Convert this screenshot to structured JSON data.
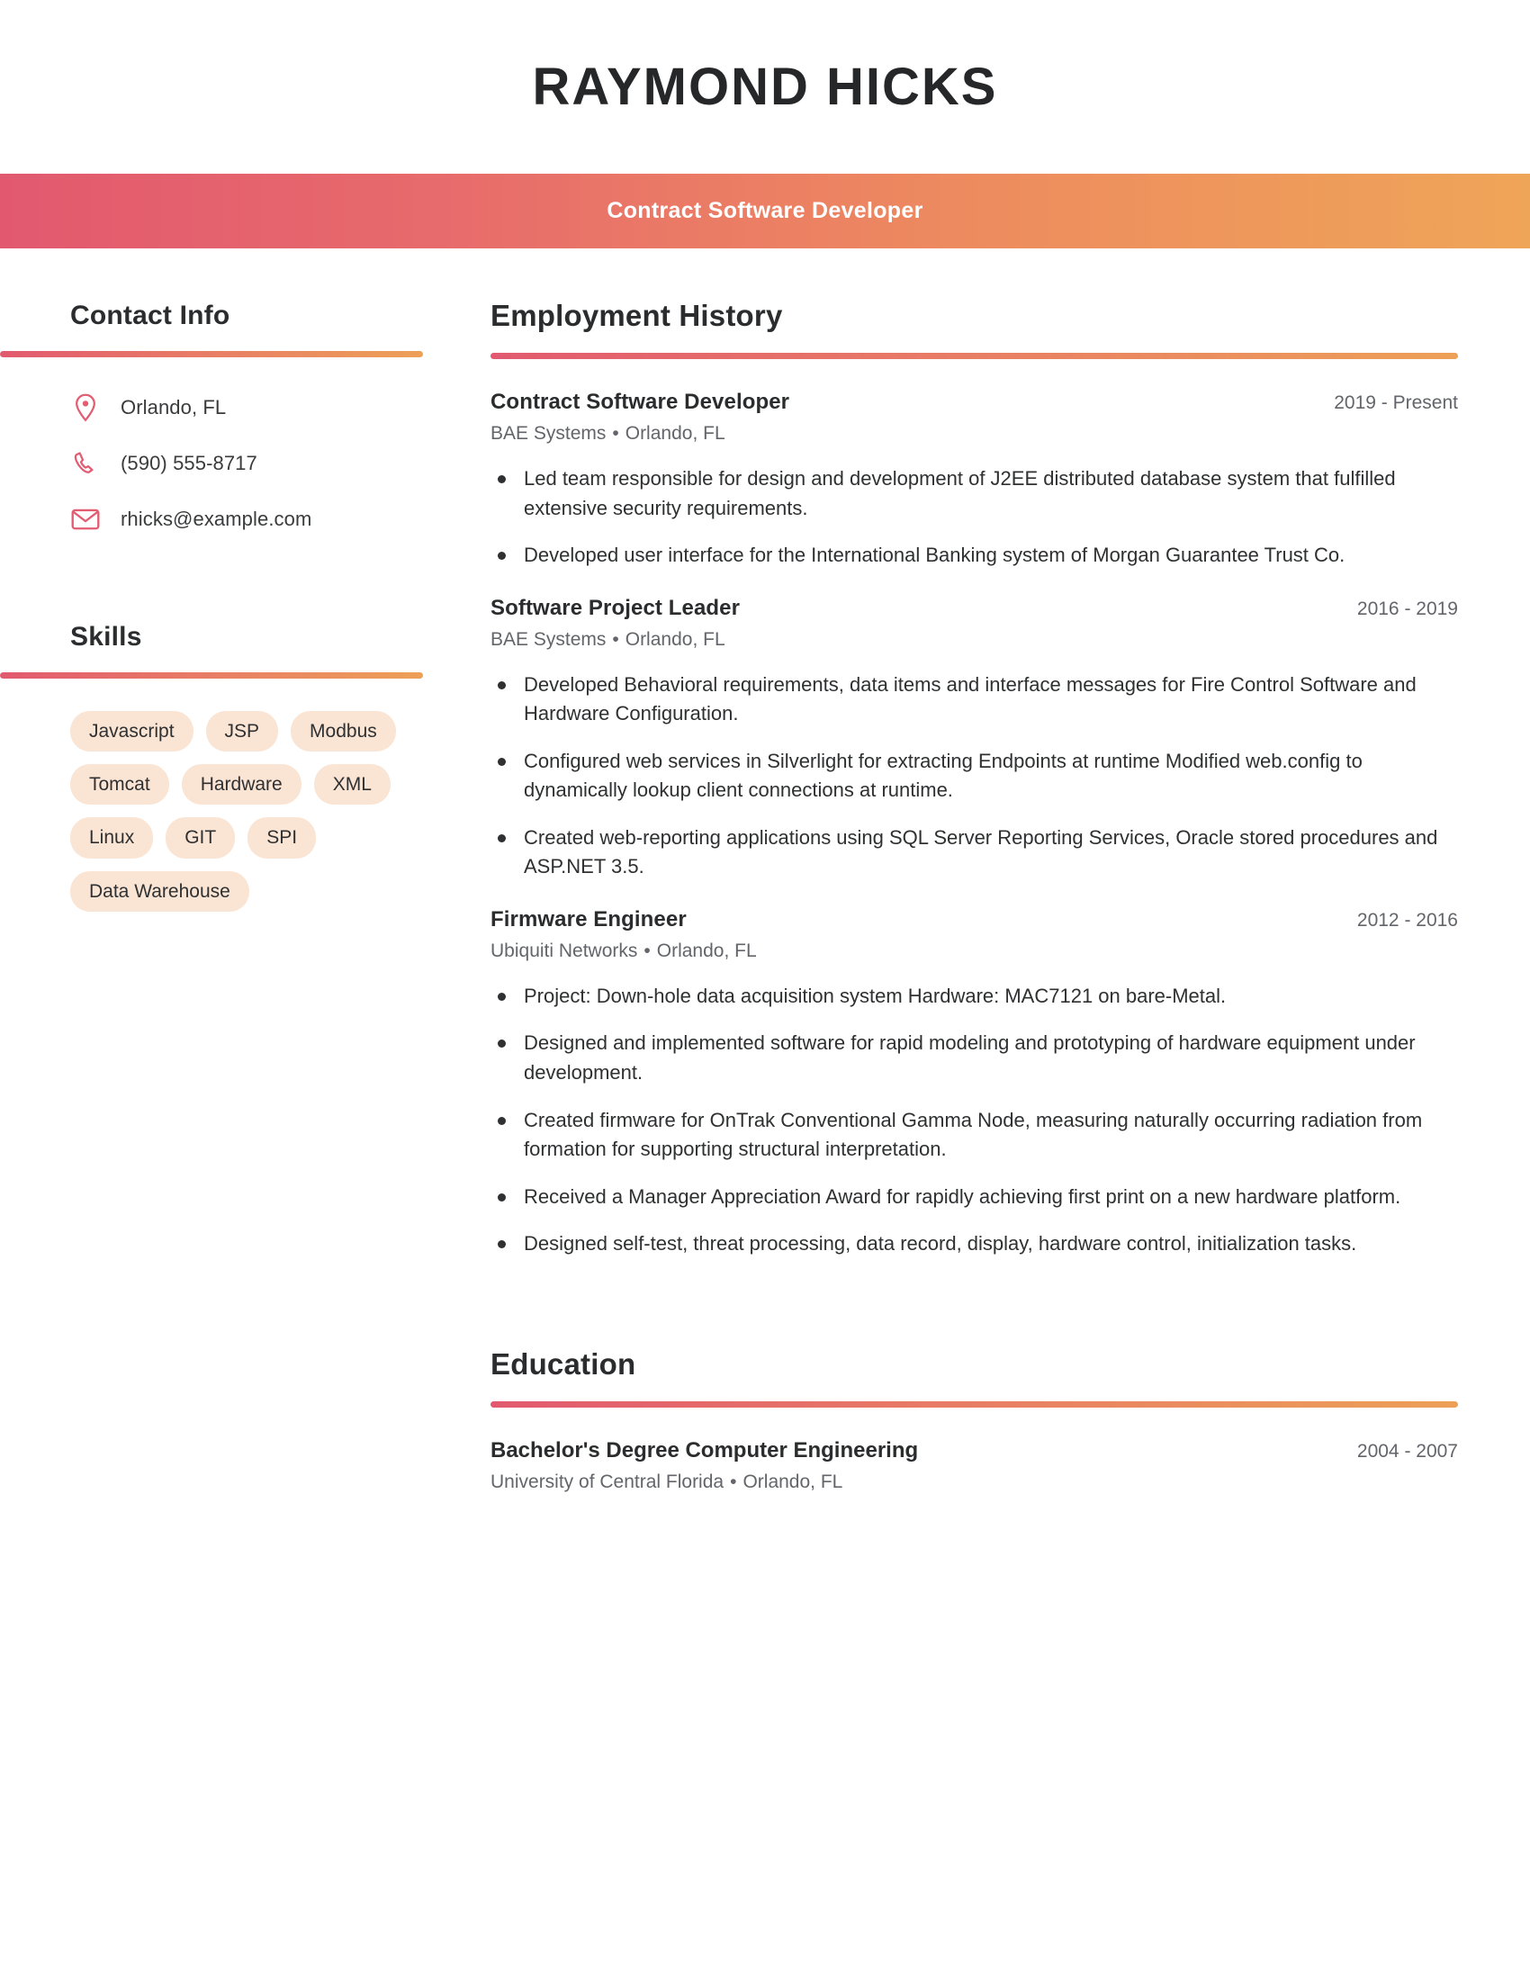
{
  "header": {
    "name": "RAYMOND HICKS",
    "title": "Contract Software Developer",
    "accent_start": "#e2596f",
    "accent_end": "#efa558"
  },
  "sidebar": {
    "contact": {
      "heading": "Contact Info",
      "items": [
        {
          "icon": "location-pin-icon",
          "value": "Orlando, FL"
        },
        {
          "icon": "phone-icon",
          "value": "(590) 555-8717"
        },
        {
          "icon": "envelope-icon",
          "value": "rhicks@example.com"
        }
      ]
    },
    "skills": {
      "heading": "Skills",
      "items": [
        "Javascript",
        "JSP",
        "Modbus",
        "Tomcat",
        "Hardware",
        "XML",
        "Linux",
        "GIT",
        "SPI",
        "Data Warehouse"
      ],
      "pill_background": "#fae4d4"
    }
  },
  "main": {
    "employment": {
      "heading": "Employment History",
      "jobs": [
        {
          "title": "Contract Software Developer",
          "dates": "2019 - Present",
          "company": "BAE Systems",
          "location": "Orlando, FL",
          "bullets": [
            "Led team responsible for design and development of J2EE distributed database system that fulfilled extensive security requirements.",
            "Developed user interface for the International Banking system of Morgan Guarantee Trust Co."
          ]
        },
        {
          "title": "Software Project Leader",
          "dates": "2016 - 2019",
          "company": "BAE Systems",
          "location": "Orlando, FL",
          "bullets": [
            "Developed Behavioral requirements, data items and interface messages for Fire Control Software and Hardware Configuration.",
            "Configured web services in Silverlight for extracting Endpoints at runtime Modified web.config to dynamically lookup client connections at runtime.",
            "Created web-reporting applications using SQL Server Reporting Services, Oracle stored procedures and ASP.NET 3.5."
          ]
        },
        {
          "title": "Firmware Engineer",
          "dates": "2012 - 2016",
          "company": "Ubiquiti Networks",
          "location": "Orlando, FL",
          "bullets": [
            "Project: Down-hole data acquisition system Hardware: MAC7121 on bare-Metal.",
            "Designed and implemented software for rapid modeling and prototyping of hardware equipment under development.",
            "Created firmware for OnTrak Conventional Gamma Node, measuring naturally occurring radiation from formation for supporting structural interpretation.",
            "Received a Manager Appreciation Award for rapidly achieving first print on a new hardware platform.",
            "Designed self-test, threat processing, data record, display, hardware control, initialization tasks."
          ]
        }
      ]
    },
    "education": {
      "heading": "Education",
      "items": [
        {
          "degree": "Bachelor's Degree Computer Engineering",
          "dates": "2004 - 2007",
          "school": "University of Central Florida",
          "location": "Orlando, FL"
        }
      ]
    }
  },
  "separator": "•"
}
